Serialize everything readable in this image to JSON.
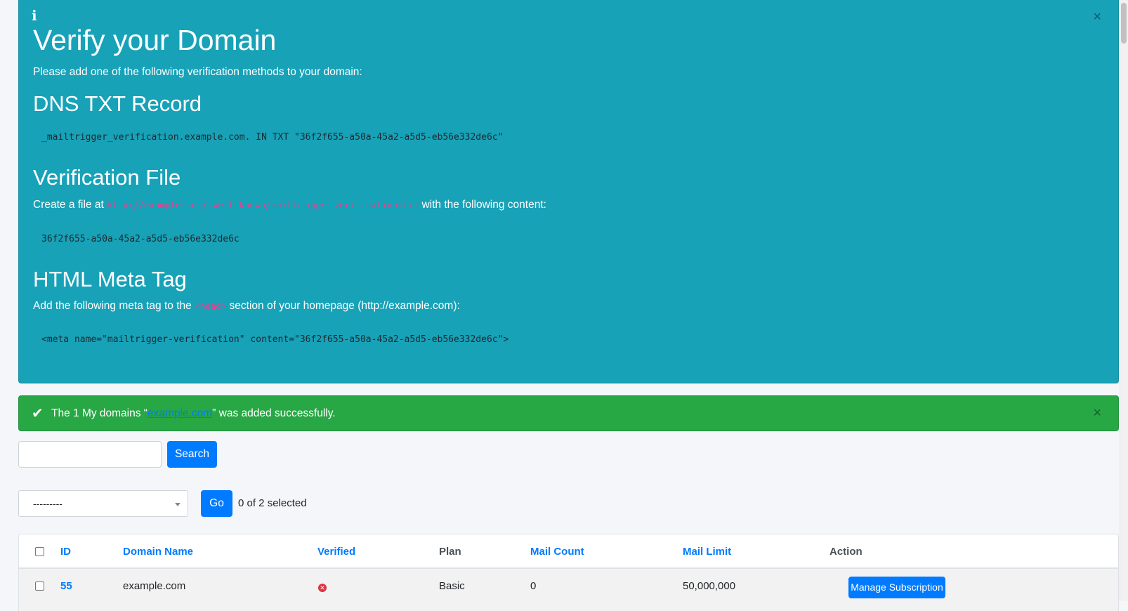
{
  "verify_alert": {
    "icon": "info-icon",
    "close": "×",
    "title": "Verify your Domain",
    "intro": "Please add one of the following verification methods to your domain:",
    "dns_heading": "DNS TXT Record",
    "dns_record": "_mailtrigger_verification.example.com. IN TXT \"36f2f655-a50a-45a2-a5d5-eb56e332de6c\"",
    "file_heading": "Verification File",
    "file_text_before": "Create a file at",
    "file_path": "http://example.com/.well-known/mailtrigger-verification.txt",
    "file_text_after": "with the following content:",
    "file_content": "36f2f655-a50a-45a2-a5d5-eb56e332de6c",
    "meta_heading": "HTML Meta Tag",
    "meta_text_before": "Add the following meta tag to the",
    "meta_code": "<head>",
    "meta_text_after": "section of your homepage (http://example.com):",
    "meta_tag": "<meta name=\"mailtrigger-verification\" content=\"36f2f655-a50a-45a2-a5d5-eb56e332de6c\">"
  },
  "success_alert": {
    "icon": "check-icon",
    "text_before": "The 1 My domains “",
    "link": "example.com",
    "text_after": "” was added successfully.",
    "close": "×"
  },
  "search": {
    "value": "",
    "button": "Search"
  },
  "actions": {
    "selected": "---------",
    "go": "Go",
    "count": "0 of 2 selected"
  },
  "table": {
    "headers": {
      "id": "ID",
      "domain": "Domain Name",
      "verified": "Verified",
      "plan": "Plan",
      "mail_count": "Mail Count",
      "mail_limit": "Mail Limit",
      "action": "Action"
    },
    "rows": [
      {
        "id": "55",
        "domain": "example.com",
        "verified": "✕",
        "plan": "Basic",
        "mail_count": "0",
        "mail_limit": "50,000,000",
        "action": "Manage Subscription"
      }
    ]
  },
  "colors": {
    "info": "#17a2b8",
    "success": "#28a745",
    "primary": "#007bff",
    "danger": "#dc3545"
  }
}
